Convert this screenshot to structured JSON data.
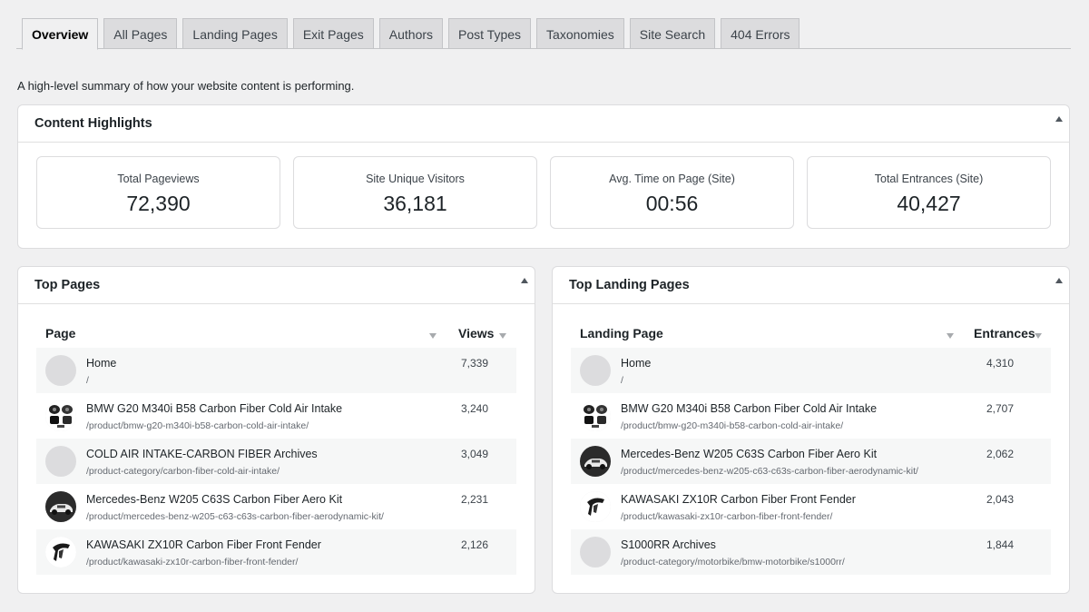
{
  "tabs": [
    {
      "label": "Overview",
      "active": true
    },
    {
      "label": "All Pages"
    },
    {
      "label": "Landing Pages"
    },
    {
      "label": "Exit Pages"
    },
    {
      "label": "Authors"
    },
    {
      "label": "Post Types"
    },
    {
      "label": "Taxonomies"
    },
    {
      "label": "Site Search"
    },
    {
      "label": "404 Errors"
    }
  ],
  "intro": "A high-level summary of how your website content is performing.",
  "highlights": {
    "title": "Content Highlights",
    "kpis": [
      {
        "label": "Total Pageviews",
        "value": "72,390"
      },
      {
        "label": "Site Unique Visitors",
        "value": "36,181"
      },
      {
        "label": "Avg. Time on Page (Site)",
        "value": "00:56"
      },
      {
        "label": "Total Entrances (Site)",
        "value": "40,427"
      }
    ]
  },
  "top_pages": {
    "title": "Top Pages",
    "col_page": "Page",
    "col_value": "Views",
    "rows": [
      {
        "title": "Home",
        "url": "/",
        "value": "7,339",
        "thumb": "placeholder"
      },
      {
        "title": "BMW G20 M340i B58 Carbon Fiber Cold Air Intake",
        "url": "/product/bmw-g20-m340i-b58-carbon-cold-air-intake/",
        "value": "3,240",
        "thumb": "intake-parts-icon"
      },
      {
        "title": "COLD AIR INTAKE-CARBON FIBER Archives",
        "url": "/product-category/carbon-fiber-cold-air-intake/",
        "value": "3,049",
        "thumb": "placeholder"
      },
      {
        "title": "Mercedes-Benz W205 C63S Carbon Fiber Aero Kit",
        "url": "/product/mercedes-benz-w205-c63-c63s-carbon-fiber-aerodynamic-kit/",
        "value": "2,231",
        "thumb": "car-icon"
      },
      {
        "title": "KAWASAKI ZX10R Carbon Fiber Front Fender",
        "url": "/product/kawasaki-zx10r-carbon-fiber-front-fender/",
        "value": "2,126",
        "thumb": "fender-icon"
      }
    ]
  },
  "top_landing": {
    "title": "Top Landing Pages",
    "col_page": "Landing Page",
    "col_value": "Entrances",
    "rows": [
      {
        "title": "Home",
        "url": "/",
        "value": "4,310",
        "thumb": "placeholder"
      },
      {
        "title": "BMW G20 M340i B58 Carbon Fiber Cold Air Intake",
        "url": "/product/bmw-g20-m340i-b58-carbon-cold-air-intake/",
        "value": "2,707",
        "thumb": "intake-parts-icon"
      },
      {
        "title": "Mercedes-Benz W205 C63S Carbon Fiber Aero Kit",
        "url": "/product/mercedes-benz-w205-c63-c63s-carbon-fiber-aerodynamic-kit/",
        "value": "2,062",
        "thumb": "car-icon"
      },
      {
        "title": "KAWASAKI ZX10R Carbon Fiber Front Fender",
        "url": "/product/kawasaki-zx10r-carbon-fiber-front-fender/",
        "value": "2,043",
        "thumb": "fender-icon"
      },
      {
        "title": "S1000RR Archives",
        "url": "/product-category/motorbike/bmw-motorbike/s1000rr/",
        "value": "1,844",
        "thumb": "placeholder"
      }
    ]
  }
}
